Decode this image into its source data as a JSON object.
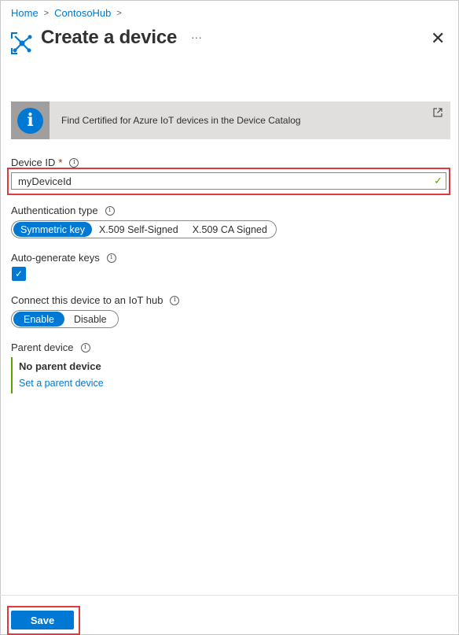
{
  "breadcrumb": {
    "home": "Home",
    "hub": "ContosoHub"
  },
  "header": {
    "title": "Create a device",
    "more": "···",
    "close": "✕"
  },
  "banner": {
    "text": "Find Certified for Azure IoT devices in the Device Catalog",
    "icon": "info-icon"
  },
  "device_id": {
    "label": "Device ID",
    "required_mark": "*",
    "value": "myDeviceId",
    "valid": true
  },
  "auth": {
    "label": "Authentication type",
    "options": [
      "Symmetric key",
      "X.509 Self-Signed",
      "X.509 CA Signed"
    ],
    "selected": "Symmetric key"
  },
  "auto_keys": {
    "label": "Auto-generate keys",
    "checked": true
  },
  "connect": {
    "label": "Connect this device to an IoT hub",
    "options": [
      "Enable",
      "Disable"
    ],
    "selected": "Enable"
  },
  "parent": {
    "label": "Parent device",
    "value": "No parent device",
    "link": "Set a parent device"
  },
  "footer": {
    "save": "Save"
  },
  "colors": {
    "accent": "#0078d4",
    "highlight": "#e0393e",
    "valid": "#57a300"
  }
}
